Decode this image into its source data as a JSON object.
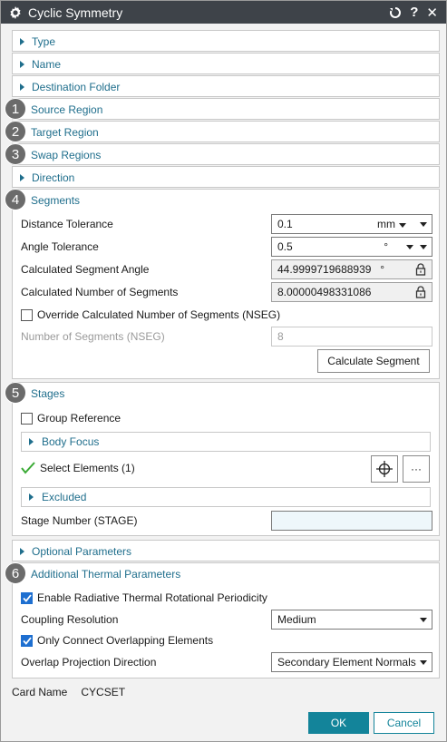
{
  "window": {
    "title": "Cyclic Symmetry",
    "icons": [
      "gear-icon",
      "reset-icon",
      "help-icon",
      "close-icon"
    ]
  },
  "groups": {
    "type": "Type",
    "name": "Name",
    "destination_folder": "Destination Folder",
    "source_region": {
      "label": "Source Region",
      "badge": "1"
    },
    "target_region": {
      "label": "Target Region",
      "badge": "2"
    },
    "swap_regions": {
      "label": "Swap Regions",
      "badge": "3"
    },
    "direction": "Direction",
    "segments": {
      "label": "Segments",
      "badge": "4"
    },
    "stages": {
      "label": "Stages",
      "badge": "5"
    },
    "optional_parameters": "Optional Parameters",
    "additional_thermal": {
      "label": "Additional Thermal Parameters",
      "badge": "6"
    }
  },
  "segments": {
    "distance_tolerance": {
      "label": "Distance Tolerance",
      "value": "0.1",
      "unit": "mm"
    },
    "angle_tolerance": {
      "label": "Angle Tolerance",
      "value": "0.5",
      "unit": "°"
    },
    "calc_segment_angle": {
      "label": "Calculated Segment Angle",
      "value": "44.9999719688939",
      "unit": "°"
    },
    "calc_num_segments": {
      "label": "Calculated Number of Segments",
      "value": "8.00000498331086"
    },
    "override": {
      "label": "Override Calculated Number of Segments (NSEG)",
      "checked": false
    },
    "nseg": {
      "label": "Number of Segments (NSEG)",
      "value": "8"
    },
    "calculate_button": "Calculate Segment"
  },
  "stages": {
    "group_reference": {
      "label": "Group Reference",
      "checked": false
    },
    "body_focus": "Body Focus",
    "select_elements": "Select Elements (1)",
    "more_button": "···",
    "excluded": "Excluded",
    "stage_number": {
      "label": "Stage Number (STAGE)",
      "value": ""
    }
  },
  "thermal": {
    "enable_radiative": {
      "label": "Enable Radiative Thermal Rotational Periodicity",
      "checked": true
    },
    "coupling_resolution": {
      "label": "Coupling Resolution",
      "value": "Medium"
    },
    "only_connect": {
      "label": "Only Connect Overlapping Elements",
      "checked": true
    },
    "overlap_direction": {
      "label": "Overlap Projection Direction",
      "value": "Secondary Element Normals"
    }
  },
  "card": {
    "label": "Card Name",
    "value": "CYCSET"
  },
  "footer": {
    "ok": "OK",
    "cancel": "Cancel"
  },
  "colors": {
    "accent": "#1f6e8c",
    "titlebar": "#3e4349",
    "ok_button": "#13849a",
    "check": "#1e6fd0",
    "success": "#3aaa35"
  }
}
